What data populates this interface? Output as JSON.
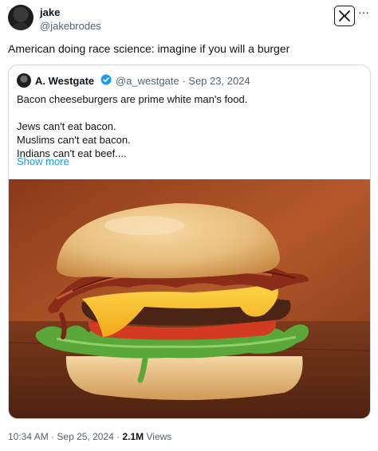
{
  "tweet": {
    "author_name": "jake",
    "author_handle": "@jakebrodes",
    "text": "American doing race science: imagine if you will a burger",
    "time": "10:34 AM",
    "date": "Sep 25, 2024",
    "views_count": "2.1M",
    "views_label": "Views"
  },
  "quoted_tweet": {
    "author_name": "A. Westgate",
    "author_handle": "@a_westgate",
    "date": "Sep 23, 2024",
    "lines": [
      "Bacon cheeseburgers are prime white man's food.",
      "",
      "Jews can't eat bacon.",
      "Muslims can't eat bacon.",
      "Indians can't eat beef...."
    ],
    "show_more_label": "Show more"
  },
  "icons": {
    "logo": "x-logo-icon",
    "more": "more-options-icon",
    "verified": "verified-badge-icon"
  },
  "colors": {
    "link": "#1d9bf0",
    "secondary_text": "#536471",
    "card_border": "#cfd9de"
  }
}
